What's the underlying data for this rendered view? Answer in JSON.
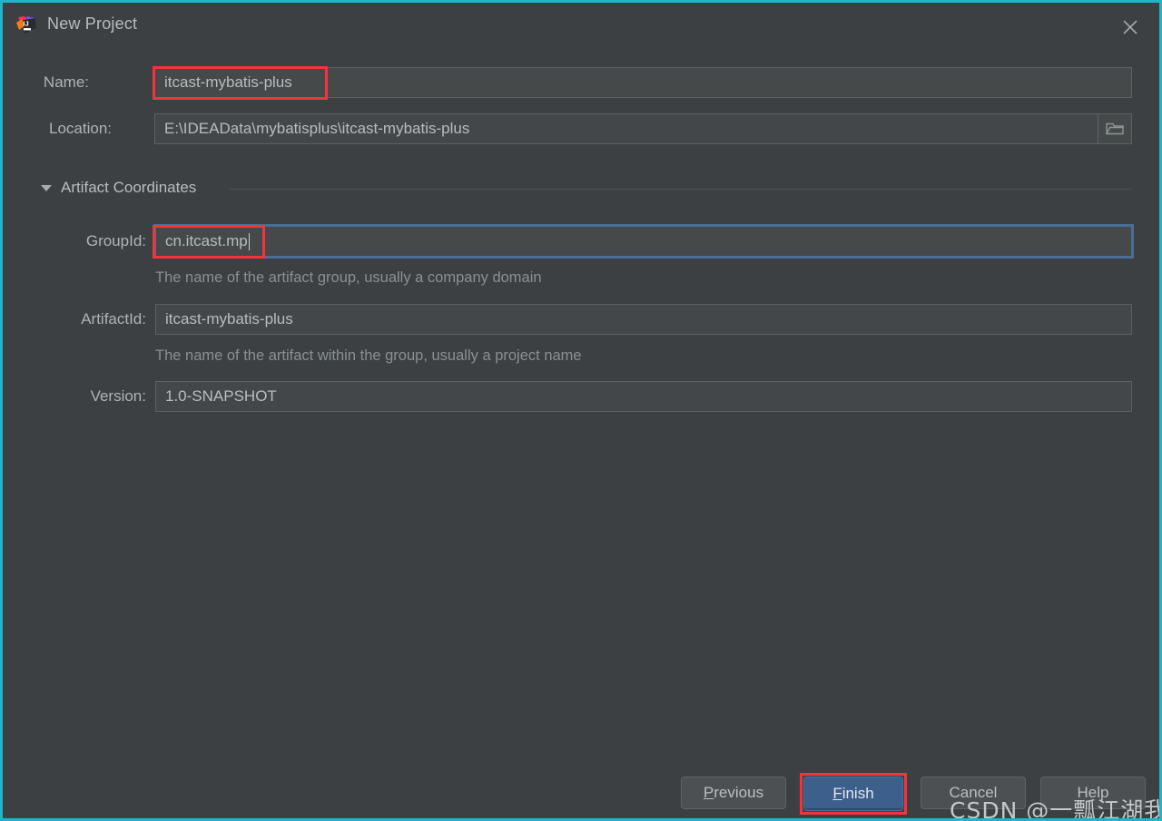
{
  "window": {
    "title": "New Project",
    "icon": "intellij-idea-logo",
    "close_icon": "close-icon",
    "border_color": "#1fb6c9",
    "background": "#3c4043"
  },
  "form": {
    "name": {
      "label": "Name:",
      "value": "itcast-mybatis-plus",
      "highlighted": true
    },
    "location": {
      "label": "Location:",
      "value": "E:\\IDEAData\\mybatisplus\\itcast-mybatis-plus",
      "browse_icon": "folder-icon"
    }
  },
  "artifact_section": {
    "title": "Artifact Coordinates",
    "expanded": true,
    "disclosure_icon": "triangle-down-icon",
    "group_id": {
      "label": "GroupId:",
      "value": "cn.itcast.mp",
      "focused": true,
      "highlighted": true,
      "hint": "The name of the artifact group, usually a company domain"
    },
    "artifact_id": {
      "label": "ArtifactId:",
      "value": "itcast-mybatis-plus",
      "hint": "The name of the artifact within the group, usually a project name"
    },
    "version": {
      "label": "Version:",
      "value": "1.0-SNAPSHOT"
    }
  },
  "footer": {
    "buttons": [
      {
        "id": "previous",
        "label": "Previous",
        "mnemonic": "P",
        "primary": false
      },
      {
        "id": "finish",
        "label": "Finish",
        "mnemonic": "F",
        "primary": true,
        "highlighted": true
      },
      {
        "id": "cancel",
        "label": "Cancel",
        "mnemonic": "",
        "primary": false
      },
      {
        "id": "help",
        "label": "Help",
        "mnemonic": "",
        "primary": false
      }
    ]
  },
  "watermark": {
    "text": "CSDN @一瓢江湖我沉浮"
  },
  "colors": {
    "accent_border": "#1fb6c9",
    "annotation_red": "#f5333f",
    "primary_button": "#3c5f8c",
    "focus_blue": "#4a6e96"
  }
}
